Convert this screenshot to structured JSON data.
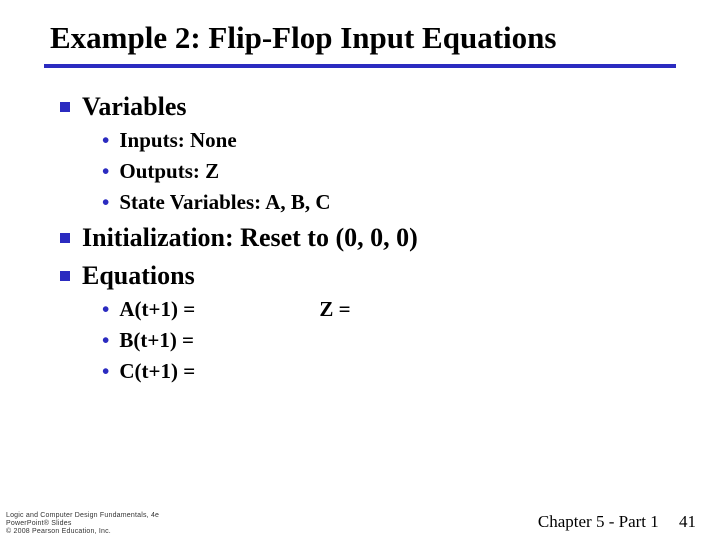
{
  "title": "Example 2: Flip-Flop Input Equations",
  "sections": {
    "variables": {
      "heading": "Variables",
      "items": {
        "inputs": "Inputs: None",
        "outputs": "Outputs: Z",
        "state": "State Variables: A, B, C"
      }
    },
    "initialization": {
      "heading": "Initialization: Reset to (0, 0, 0)"
    },
    "equations": {
      "heading": "Equations",
      "items": {
        "a": "A(t+1) =",
        "b": "B(t+1) =",
        "c": "C(t+1) =",
        "z": "Z ="
      }
    }
  },
  "footer": {
    "chapter": "Chapter 5 - Part 1",
    "page": "41"
  },
  "copyright": {
    "line1": "Logic and Computer Design Fundamentals, 4e",
    "line2": "PowerPoint® Slides",
    "line3": "© 2008 Pearson Education, Inc."
  },
  "colors": {
    "accent": "#2b2bc0"
  }
}
